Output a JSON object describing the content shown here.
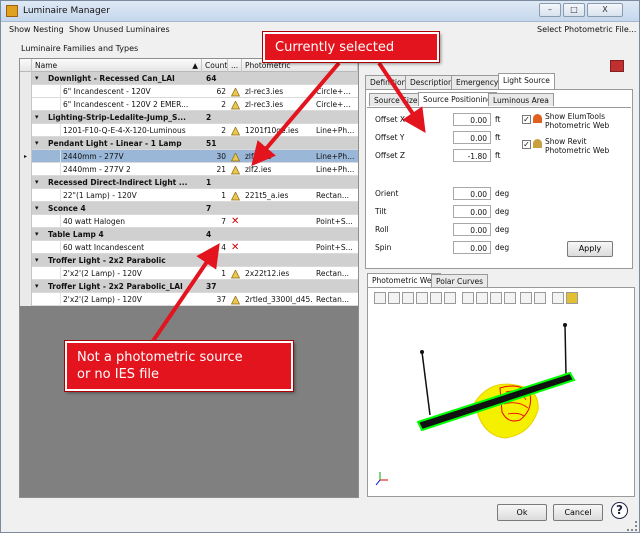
{
  "window": {
    "title": "Luminaire Manager",
    "minimize": "–",
    "maximize": "□",
    "close": "X"
  },
  "menu": {
    "show_nesting": "Show Nesting",
    "show_unused": "Show Unused Luminaires",
    "select_file": "Select Photometric File..."
  },
  "families_label": "Luminaire Families and Types",
  "grid": {
    "columns": [
      "Name",
      "Count",
      "...",
      "Photometric"
    ],
    "rows": [
      {
        "type": "group",
        "name": "Downlight - Recessed Can_LAI",
        "count": "64"
      },
      {
        "type": "item",
        "name": "6\" Incandescent - 120V",
        "count": "62",
        "icon": "lamp",
        "file": "zl-rec3.ies",
        "shape": "Circle+..."
      },
      {
        "type": "item",
        "name": "6\" Incandescent - 120V 2 EMER...",
        "count": "2",
        "icon": "lamp",
        "file": "zl-rec3.ies",
        "shape": "Circle+..."
      },
      {
        "type": "group",
        "name": "Lighting-Strip-Ledalite-Jump_S...",
        "count": "2"
      },
      {
        "type": "item",
        "name": "1201-F10-Q-E-4-X-120-Luminous",
        "count": "2",
        "icon": "lamp",
        "file": "1201f10qe.ies",
        "shape": "Line+Ph..."
      },
      {
        "type": "group",
        "name": "Pendant Light - Linear - 1 Lamp",
        "count": "51"
      },
      {
        "type": "item",
        "name": "2440mm - 277V",
        "count": "30",
        "icon": "lamp",
        "file": "zlf1.ies",
        "shape": "Line+Ph...",
        "selected": true
      },
      {
        "type": "item",
        "name": "2440mm - 277V 2",
        "count": "21",
        "icon": "lamp",
        "file": "zlf2.ies",
        "shape": "Line+Ph..."
      },
      {
        "type": "group",
        "name": "Recessed Direct-Indirect Light ...",
        "count": "1"
      },
      {
        "type": "item",
        "name": "22\"(1 Lamp) - 120V",
        "count": "1",
        "icon": "lamp",
        "file": "221t5_a.ies",
        "shape": "Rectan..."
      },
      {
        "type": "group",
        "name": "Sconce 4",
        "count": "7"
      },
      {
        "type": "item",
        "name": "40 watt Halogen",
        "count": "7",
        "icon": "x",
        "file": "",
        "shape": "Point+S..."
      },
      {
        "type": "group",
        "name": "Table Lamp 4",
        "count": "4"
      },
      {
        "type": "item",
        "name": "60 watt Incandescent",
        "count": "4",
        "icon": "x",
        "file": "",
        "shape": "Point+S..."
      },
      {
        "type": "group",
        "name": "Troffer Light - 2x2 Parabolic",
        "count": "1"
      },
      {
        "type": "item",
        "name": "2'x2'(2 Lamp) - 120V",
        "count": "1",
        "icon": "lamp",
        "file": "2x22t12.ies",
        "shape": "Rectan..."
      },
      {
        "type": "group",
        "name": "Troffer Light - 2x2 Parabolic_LAI",
        "count": "37"
      },
      {
        "type": "item",
        "name": "2'x2'(2 Lamp) - 120V",
        "count": "37",
        "icon": "lamp",
        "file": "2rtled_3300l_d45...",
        "shape": "Rectan..."
      }
    ]
  },
  "tabs": [
    "Definition",
    "Description",
    "Emergency",
    "Light Source"
  ],
  "subtabs": [
    "Source Size",
    "Source Positioning",
    "Luminous Area"
  ],
  "positioning": {
    "offset_x_label": "Offset X",
    "offset_x": "0.00",
    "offset_x_unit": "ft",
    "offset_y_label": "Offset Y",
    "offset_y": "0.00",
    "offset_y_unit": "ft",
    "offset_z_label": "Offset Z",
    "offset_z": "-1.80",
    "offset_z_unit": "ft",
    "orient_label": "Orient",
    "orient": "0.00",
    "orient_unit": "deg",
    "tilt_label": "Tilt",
    "tilt": "0.00",
    "tilt_unit": "deg",
    "roll_label": "Roll",
    "roll": "0.00",
    "roll_unit": "deg",
    "spin_label": "Spin",
    "spin": "0.00",
    "spin_unit": "deg",
    "show_elum_line1": "Show ElumTools",
    "show_elum_line2": "Photometric Web",
    "show_revit_line1": "Show Revit",
    "show_revit_line2": "Photometric Web",
    "apply": "Apply"
  },
  "view_tabs": [
    "Photometric Web",
    "Polar Curves"
  ],
  "callouts": {
    "selected": "Currently selected",
    "not_source_line1": "Not a photometric source",
    "not_source_line2": "or no IES file"
  },
  "footer": {
    "ok": "Ok",
    "cancel": "Cancel",
    "help": "?"
  },
  "colors": {
    "callout": "#e3141e",
    "selected_row": "#9ab7d8",
    "group_row": "#d0d0d0"
  }
}
